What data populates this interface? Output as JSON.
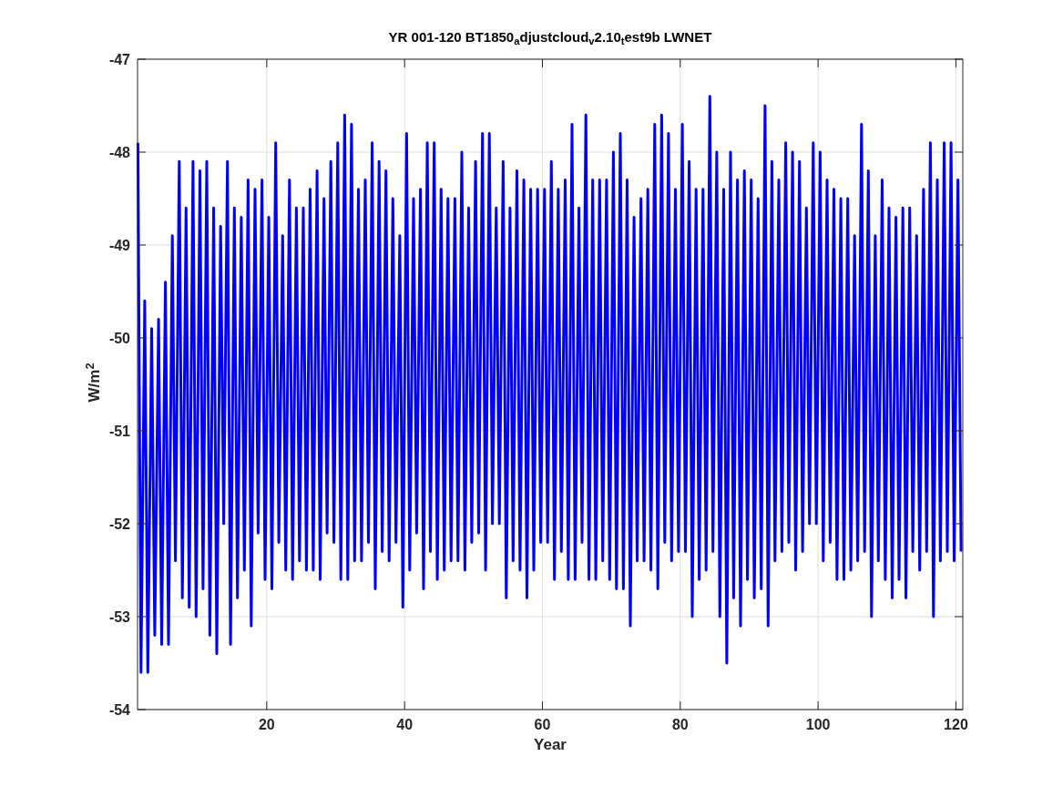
{
  "figure": {
    "chart_data": {
      "type": "line",
      "title": "YR 001-120 BT1850$_{a}$djustcloud$_{v}$2.10$_{t}$est9b LWNET",
      "xlabel": "Year",
      "ylabel": "W/m$^{2}$",
      "grid": true,
      "xlim": [
        1.25,
        121
      ],
      "ylim": [
        -54,
        -47
      ],
      "xticks": [
        20,
        40,
        60,
        80,
        100,
        120
      ],
      "yticks": [
        -54,
        -53,
        -52,
        -51,
        -50,
        -49,
        -48,
        -47
      ],
      "x": [
        1.3,
        1.75,
        2.3,
        2.75,
        3.3,
        3.75,
        4.3,
        4.75,
        5.3,
        5.75,
        6.3,
        6.75,
        7.3,
        7.75,
        8.3,
        8.75,
        9.3,
        9.75,
        10.3,
        10.75,
        11.3,
        11.75,
        12.3,
        12.75,
        13.3,
        13.75,
        14.3,
        14.75,
        15.3,
        15.75,
        16.3,
        16.75,
        17.3,
        17.75,
        18.3,
        18.75,
        19.3,
        19.75,
        20.3,
        20.75,
        21.3,
        21.75,
        22.3,
        22.75,
        23.3,
        23.75,
        24.3,
        24.75,
        25.3,
        25.75,
        26.3,
        26.75,
        27.3,
        27.75,
        28.3,
        28.75,
        29.3,
        29.75,
        30.3,
        30.75,
        31.3,
        31.75,
        32.3,
        32.75,
        33.3,
        33.75,
        34.3,
        34.75,
        35.3,
        35.75,
        36.3,
        36.75,
        37.3,
        37.75,
        38.3,
        38.75,
        39.3,
        39.75,
        40.3,
        40.75,
        41.3,
        41.75,
        42.3,
        42.75,
        43.3,
        43.75,
        44.3,
        44.75,
        45.3,
        45.75,
        46.3,
        46.75,
        47.3,
        47.75,
        48.3,
        48.75,
        49.3,
        49.75,
        50.3,
        50.75,
        51.3,
        51.75,
        52.3,
        52.75,
        53.3,
        53.75,
        54.3,
        54.75,
        55.3,
        55.75,
        56.3,
        56.75,
        57.3,
        57.75,
        58.3,
        58.75,
        59.3,
        59.75,
        60.3,
        60.75,
        61.3,
        61.75,
        62.3,
        62.75,
        63.3,
        63.75,
        64.3,
        64.75,
        65.3,
        65.75,
        66.3,
        66.75,
        67.3,
        67.75,
        68.3,
        68.75,
        69.3,
        69.75,
        70.3,
        70.75,
        71.3,
        71.75,
        72.3,
        72.75,
        73.3,
        73.75,
        74.3,
        74.75,
        75.3,
        75.75,
        76.3,
        76.75,
        77.3,
        77.75,
        78.3,
        78.75,
        79.3,
        79.75,
        80.3,
        80.75,
        81.3,
        81.75,
        82.3,
        82.75,
        83.3,
        83.75,
        84.3,
        84.75,
        85.3,
        85.75,
        86.3,
        86.75,
        87.3,
        87.75,
        88.3,
        88.75,
        89.3,
        89.75,
        90.3,
        90.75,
        91.3,
        91.75,
        92.3,
        92.75,
        93.3,
        93.75,
        94.3,
        94.75,
        95.3,
        95.75,
        96.3,
        96.75,
        97.3,
        97.75,
        98.3,
        98.75,
        99.3,
        99.75,
        100.3,
        100.75,
        101.3,
        101.75,
        102.3,
        102.75,
        103.3,
        103.75,
        104.3,
        104.75,
        105.3,
        105.75,
        106.3,
        106.75,
        107.3,
        107.75,
        108.3,
        108.75,
        109.3,
        109.75,
        110.3,
        110.75,
        111.3,
        111.75,
        112.3,
        112.75,
        113.3,
        113.75,
        114.3,
        114.75,
        115.3,
        115.75,
        116.3,
        116.75,
        117.3,
        117.75,
        118.3,
        118.75,
        119.3,
        119.75,
        120.3,
        120.75
      ],
      "series": [
        {
          "color": "#0000ff",
          "values": [
            -47.9,
            -53.6,
            -49.6,
            -53.6,
            -49.9,
            -53.2,
            -49.8,
            -53.3,
            -49.4,
            -53.3,
            -48.9,
            -52.4,
            -48.1,
            -52.8,
            -48.6,
            -52.9,
            -48.1,
            -53.0,
            -48.2,
            -52.7,
            -48.1,
            -53.2,
            -48.6,
            -53.4,
            -48.8,
            -52.0,
            -48.1,
            -53.3,
            -48.6,
            -52.8,
            -48.7,
            -52.5,
            -48.3,
            -53.1,
            -48.4,
            -52.1,
            -48.3,
            -52.6,
            -48.7,
            -52.7,
            -47.9,
            -52.2,
            -48.9,
            -52.5,
            -48.3,
            -52.6,
            -48.6,
            -52.4,
            -48.6,
            -52.5,
            -48.4,
            -52.5,
            -48.2,
            -52.6,
            -48.5,
            -52.1,
            -48.1,
            -52.2,
            -47.9,
            -52.6,
            -47.6,
            -52.6,
            -47.7,
            -52.4,
            -48.4,
            -52.4,
            -48.3,
            -52.2,
            -47.9,
            -52.7,
            -48.1,
            -52.3,
            -48.2,
            -52.4,
            -48.5,
            -52.2,
            -48.9,
            -52.9,
            -47.8,
            -52.5,
            -48.5,
            -52.1,
            -48.4,
            -52.7,
            -47.9,
            -52.3,
            -47.9,
            -52.6,
            -48.4,
            -52.5,
            -48.5,
            -52.4,
            -48.5,
            -52.4,
            -48.0,
            -52.5,
            -48.6,
            -52.2,
            -48.1,
            -52.1,
            -47.8,
            -52.5,
            -47.8,
            -52.0,
            -48.6,
            -52.0,
            -48.1,
            -52.8,
            -48.6,
            -52.4,
            -48.2,
            -52.5,
            -48.3,
            -52.8,
            -48.4,
            -52.5,
            -48.4,
            -52.2,
            -48.4,
            -52.2,
            -48.1,
            -52.6,
            -48.4,
            -52.3,
            -48.3,
            -52.6,
            -47.7,
            -52.6,
            -48.6,
            -52.2,
            -47.6,
            -52.6,
            -48.3,
            -52.6,
            -48.3,
            -52.4,
            -48.3,
            -52.6,
            -48.0,
            -52.7,
            -47.8,
            -52.7,
            -48.3,
            -53.1,
            -48.7,
            -52.4,
            -48.5,
            -52.4,
            -48.4,
            -52.5,
            -47.7,
            -52.7,
            -47.6,
            -52.2,
            -47.8,
            -52.4,
            -48.4,
            -52.3,
            -47.7,
            -52.3,
            -48.1,
            -53.0,
            -48.4,
            -52.6,
            -48.4,
            -52.5,
            -47.4,
            -52.3,
            -48.0,
            -53.0,
            -48.4,
            -53.5,
            -48.0,
            -52.8,
            -48.3,
            -53.1,
            -48.2,
            -52.6,
            -48.3,
            -52.8,
            -48.5,
            -52.7,
            -47.5,
            -53.1,
            -48.1,
            -52.4,
            -48.3,
            -52.3,
            -47.9,
            -52.2,
            -48.0,
            -52.5,
            -48.1,
            -52.3,
            -48.6,
            -52.0,
            -47.9,
            -52.0,
            -48.0,
            -52.4,
            -48.3,
            -52.2,
            -48.4,
            -52.6,
            -48.5,
            -52.6,
            -48.5,
            -52.5,
            -48.9,
            -52.4,
            -47.7,
            -52.3,
            -48.2,
            -53.0,
            -48.9,
            -52.4,
            -48.3,
            -52.6,
            -48.6,
            -52.8,
            -48.7,
            -52.6,
            -48.6,
            -52.8,
            -48.6,
            -52.3,
            -48.9,
            -52.5,
            -48.4,
            -52.3,
            -47.9,
            -53.0,
            -48.3,
            -52.4,
            -47.9,
            -52.3,
            -47.9,
            -52.4,
            -48.3,
            -52.3
          ]
        }
      ]
    }
  }
}
